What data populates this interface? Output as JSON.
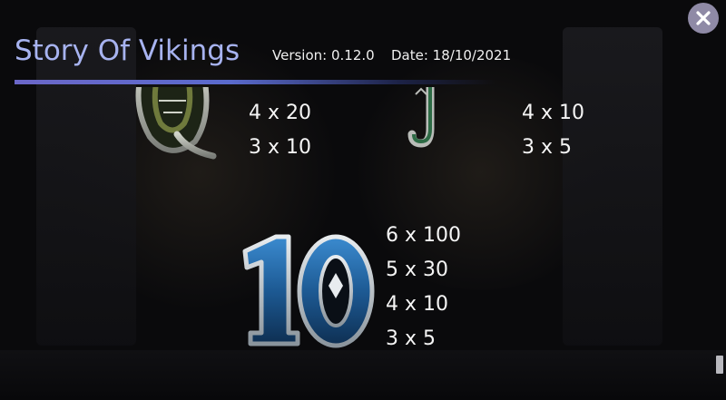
{
  "header": {
    "title": "Story Of Vikings",
    "version": "Version: 0.12.0",
    "date": "Date: 18/10/2021"
  },
  "close_button": {
    "icon": "close-icon"
  },
  "symbols": [
    {
      "name": "Q",
      "icon": "q-symbol-icon",
      "payouts": [
        "4 x 20",
        "3 x 10"
      ]
    },
    {
      "name": "J",
      "icon": "j-symbol-icon",
      "payouts": [
        "4 x 10",
        "3 x 5"
      ]
    },
    {
      "name": "10",
      "icon": "ten-symbol-icon",
      "payouts": [
        "6 x 100",
        "5 x 30",
        "4 x 10",
        "3 x 5"
      ]
    }
  ],
  "colors": {
    "title": "#a7b3f0",
    "accent_line": "#6b67c8",
    "close_bg": "#8f8aa6"
  }
}
